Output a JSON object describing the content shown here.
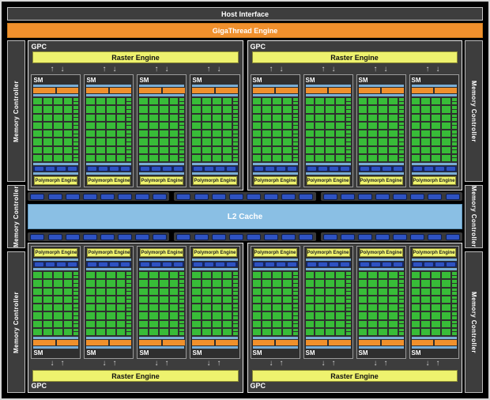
{
  "host_interface": {
    "label": "Host Interface"
  },
  "gigathread_engine": {
    "label": "GigaThread Engine"
  },
  "memory_controller": {
    "label": "Memory Controller",
    "left_count": 3,
    "right_count": 3
  },
  "l2_cache": {
    "label": "L2 Cache",
    "strip_groups": 3,
    "blocks_per_group": 8
  },
  "gpc": {
    "label": "GPC",
    "count": 4,
    "top_count": 2,
    "bottom_count": 2,
    "raster_engine_label": "Raster Engine",
    "arrow_pairs_per_gpc": 4,
    "sms_per_gpc": 4,
    "sm": {
      "label": "SM",
      "polymorph_engine_label": "Polymorph Engine",
      "orange_segments": 2,
      "navy_segments": 4,
      "core_rows": 8,
      "core_cols": 4,
      "mini_cells_per_row": 2
    }
  },
  "colors": {
    "background": "#000000",
    "frame_border": "#d9d9d9",
    "bar_gray": "#3d3d3d",
    "orange": "#f0902c",
    "yellow": "#eef26e",
    "light_blue": "#7aaed6",
    "l2_blue": "#8abfe4",
    "green": "#38bc38",
    "navy": "#16265e",
    "segment_blue": "#2e52c2"
  }
}
